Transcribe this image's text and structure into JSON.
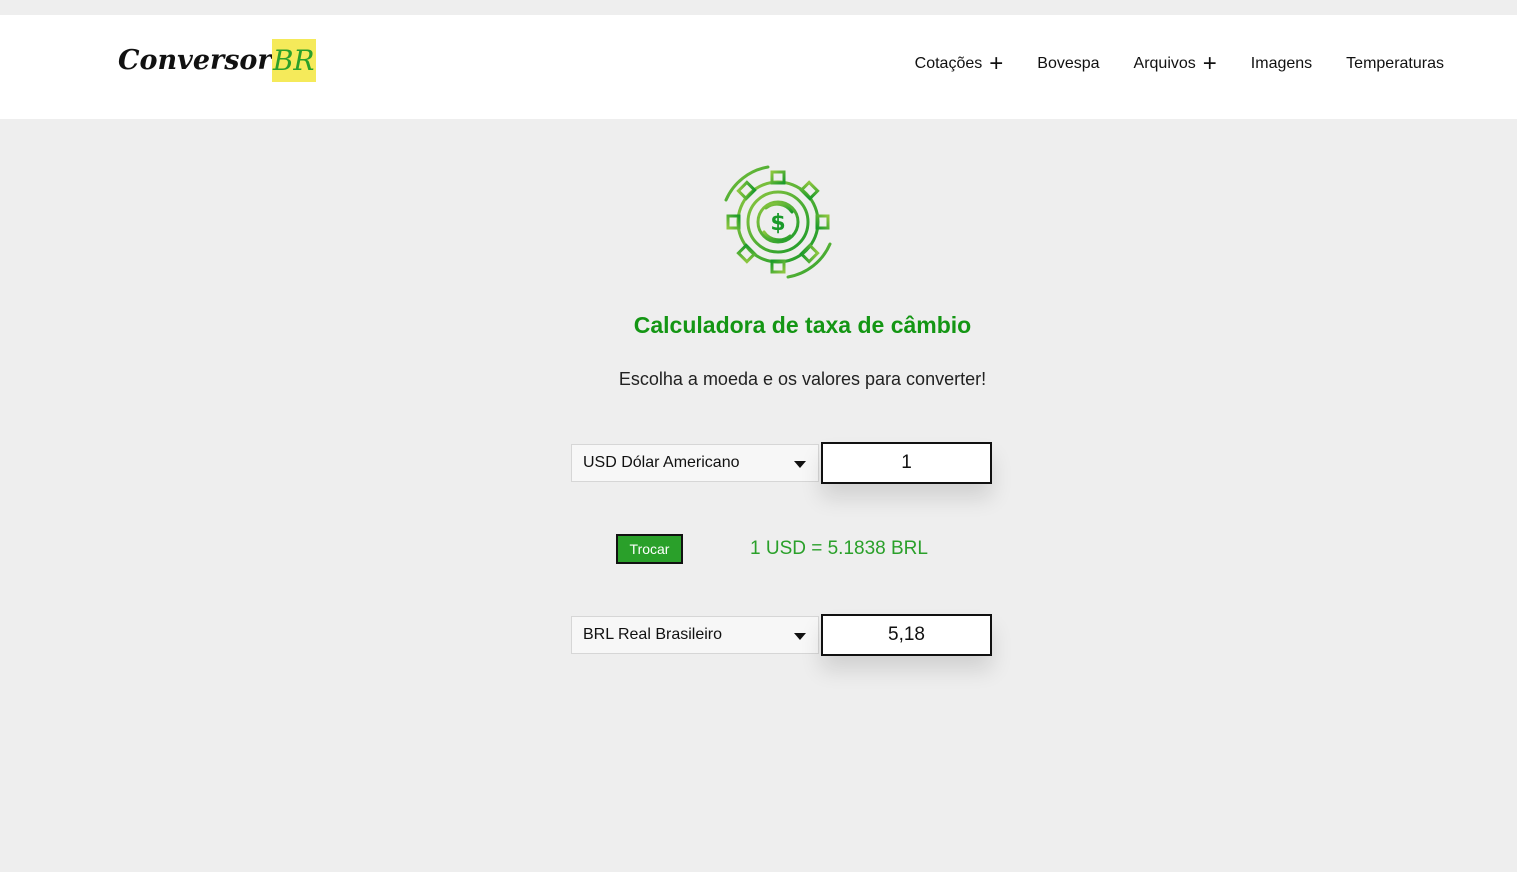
{
  "header": {
    "logo_text": "Conversor",
    "logo_badge": "BR",
    "nav": [
      {
        "label": "Cotações",
        "has_plus": true
      },
      {
        "label": "Bovespa",
        "has_plus": false
      },
      {
        "label": "Arquivos",
        "has_plus": true
      },
      {
        "label": "Imagens",
        "has_plus": false
      },
      {
        "label": "Temperaturas",
        "has_plus": false
      }
    ],
    "plus_symbol": "+"
  },
  "main": {
    "icon": "currency-exchange-gear-icon",
    "title": "Calculadora de taxa de câmbio",
    "subtitle": "Escolha a moeda e os valores para converter!",
    "from": {
      "currency": "USD Dólar Americano",
      "amount": "1"
    },
    "swap_label": "Trocar",
    "rate_text": "1 USD = 5.1838 BRL",
    "to": {
      "currency": "BRL Real Brasileiro",
      "amount": "5,18"
    }
  },
  "colors": {
    "accent_green": "#149614",
    "button_green": "#2aa02a",
    "logo_badge_bg": "#f5ea5a",
    "page_bg": "#eeeeee"
  }
}
